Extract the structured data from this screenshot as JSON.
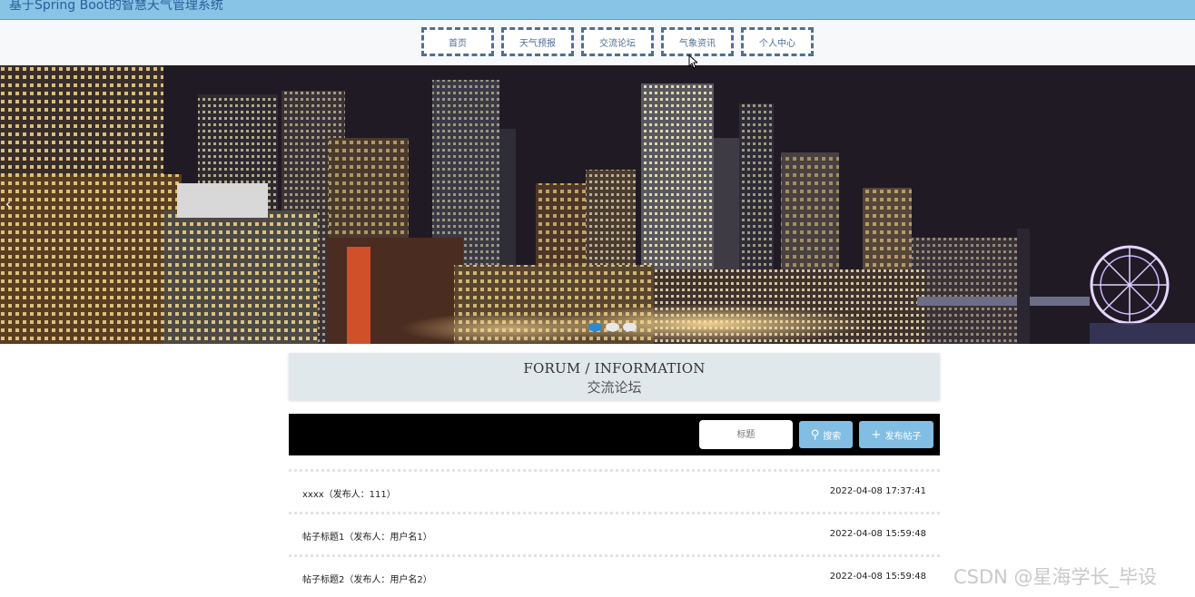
{
  "header": {
    "title": "基于Spring Boot的智慧天气管理系统"
  },
  "nav": {
    "items": [
      "首页",
      "天气预报",
      "交流论坛",
      "气象资讯",
      "个人中心"
    ]
  },
  "banner": {
    "prev_icon": "chevron-left-icon",
    "dot_count": 3,
    "active_dot": 0
  },
  "section": {
    "title_en": "FORUM / INFORMATION",
    "title_cn": "交流论坛"
  },
  "search": {
    "placeholder": "标题",
    "search_label": "搜索",
    "add_label": "发布帖子",
    "search_icon": "magnifier-icon",
    "add_icon": "plus-icon"
  },
  "posts": [
    {
      "title": "xxxx（发布人：111）",
      "time": "2022-04-08 17:37:41"
    },
    {
      "title": "帖子标题1（发布人：用户名1）",
      "time": "2022-04-08 15:59:48"
    },
    {
      "title": "帖子标题2（发布人：用户名2）",
      "time": "2022-04-08 15:59:48"
    }
  ],
  "watermark": "CSDN @星海学长_毕设",
  "colors": {
    "header_bg": "#87c4e6",
    "nav_border": "#4e6f96",
    "button_bg": "#82bde3",
    "active_dot": "#2b8ad1"
  }
}
